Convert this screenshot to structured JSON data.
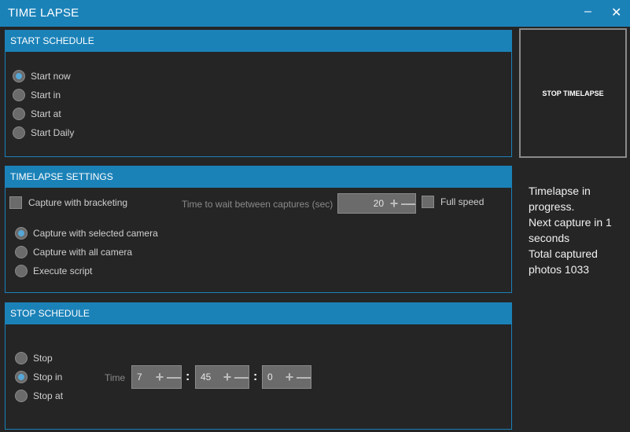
{
  "window": {
    "title": "TIME LAPSE",
    "minimize_icon": "minimize-icon",
    "close_icon": "close-icon"
  },
  "start_schedule": {
    "header": "START SCHEDULE",
    "options": [
      {
        "label": "Start now",
        "checked": true
      },
      {
        "label": "Start in",
        "checked": false
      },
      {
        "label": "Start at",
        "checked": false
      },
      {
        "label": "Start Daily",
        "checked": false
      }
    ]
  },
  "timelapse_settings": {
    "header": "TIMELAPSE SETTINGS",
    "bracketing_label": "Capture with bracketing",
    "bracketing_checked": false,
    "wait_label": "Time to wait between captures (sec)",
    "wait_value": "20",
    "full_speed_label": "Full speed",
    "full_speed_checked": false,
    "options": [
      {
        "label": "Capture with selected camera",
        "checked": true
      },
      {
        "label": "Capture with all camera",
        "checked": false
      },
      {
        "label": "Execute script",
        "checked": false
      }
    ]
  },
  "stop_schedule": {
    "header": "STOP SCHEDULE",
    "options": [
      {
        "label": "Stop",
        "checked": false
      },
      {
        "label": "Stop in",
        "checked": true
      },
      {
        "label": "Stop at",
        "checked": false
      }
    ],
    "time_label": "Time",
    "hours": "7",
    "minutes": "45",
    "seconds": "0",
    "separator": ":"
  },
  "stop_button_label": "STOP TIMELAPSE",
  "status_lines": [
    "Timelapse in progress.",
    "Next capture in 1 seconds",
    "Total captured photos 1033"
  ],
  "colors": {
    "accent": "#1b82b8",
    "background": "#252526",
    "control": "#6b6b6b",
    "radio_dot": "#55a8d8"
  }
}
